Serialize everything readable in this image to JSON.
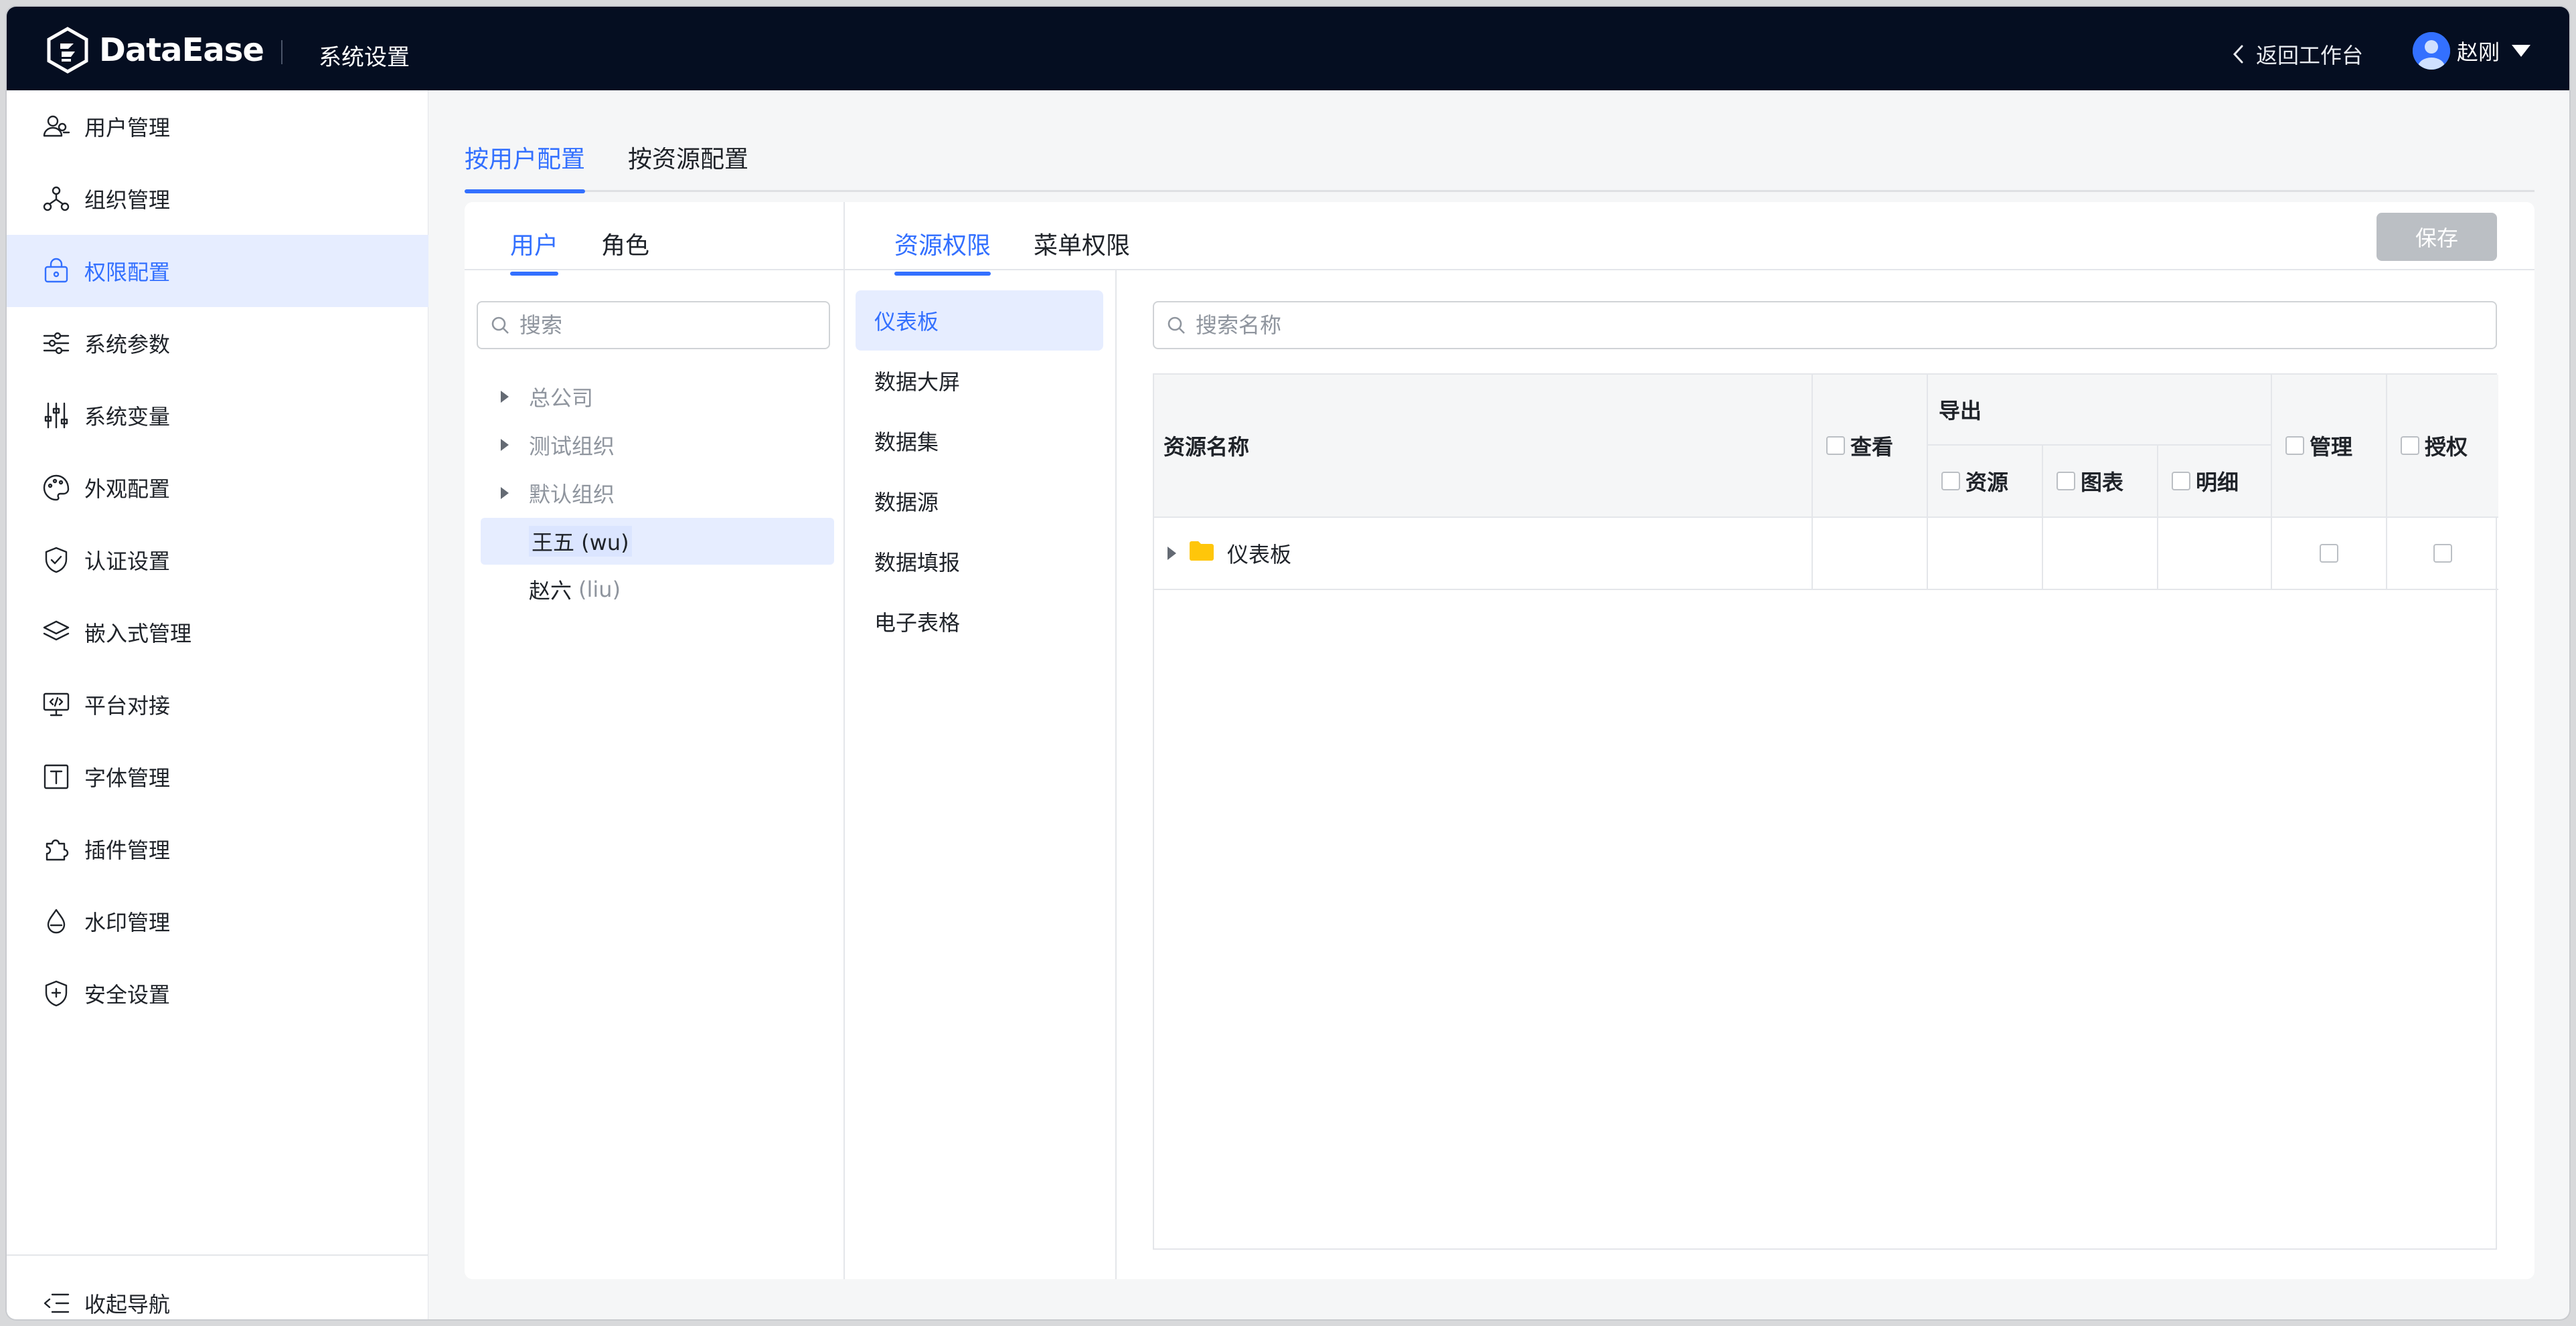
{
  "header": {
    "logo_text": "DataEase",
    "section_title": "系统设置",
    "back_label": "返回工作台",
    "user_name": "赵刚"
  },
  "sidebar": {
    "items": [
      {
        "label": "用户管理",
        "icon": "users-icon"
      },
      {
        "label": "组织管理",
        "icon": "org-icon"
      },
      {
        "label": "权限配置",
        "icon": "lock-icon",
        "active": true
      },
      {
        "label": "系统参数",
        "icon": "sliders-icon"
      },
      {
        "label": "系统变量",
        "icon": "variables-icon"
      },
      {
        "label": "外观配置",
        "icon": "palette-icon"
      },
      {
        "label": "认证设置",
        "icon": "shield-check-icon"
      },
      {
        "label": "嵌入式管理",
        "icon": "layers-icon"
      },
      {
        "label": "平台对接",
        "icon": "monitor-code-icon"
      },
      {
        "label": "字体管理",
        "icon": "font-icon"
      },
      {
        "label": "插件管理",
        "icon": "puzzle-icon"
      },
      {
        "label": "水印管理",
        "icon": "drop-icon"
      },
      {
        "label": "安全设置",
        "icon": "shield-plus-icon"
      }
    ],
    "collapse_label": "收起导航"
  },
  "main_tabs": [
    {
      "label": "按用户配置",
      "active": true
    },
    {
      "label": "按资源配置",
      "active": false
    }
  ],
  "left_panel": {
    "tabs": [
      {
        "label": "用户",
        "active": true
      },
      {
        "label": "角色",
        "active": false
      }
    ],
    "search_placeholder": "搜索",
    "tree": [
      {
        "label": "总公司",
        "type": "org"
      },
      {
        "label": "测试组织",
        "type": "org"
      },
      {
        "label": "默认组织",
        "type": "org"
      },
      {
        "label": "王五 (wu)",
        "type": "user",
        "selected": true
      },
      {
        "label": "赵六",
        "sub": "(liu)",
        "type": "user"
      }
    ]
  },
  "permission_tabs": [
    {
      "label": "资源权限",
      "active": true
    },
    {
      "label": "菜单权限",
      "active": false
    }
  ],
  "save_label": "保存",
  "resource_types": [
    {
      "label": "仪表板",
      "active": true
    },
    {
      "label": "数据大屏"
    },
    {
      "label": "数据集"
    },
    {
      "label": "数据源"
    },
    {
      "label": "数据填报"
    },
    {
      "label": "电子表格"
    }
  ],
  "right_panel": {
    "search_placeholder": "搜索名称",
    "columns": {
      "name": "资源名称",
      "view": "查看",
      "export": "导出",
      "export_resource": "资源",
      "export_chart": "图表",
      "export_detail": "明细",
      "manage": "管理",
      "authorize": "授权"
    },
    "rows": [
      {
        "name": "仪表板",
        "icon": "folder-icon"
      }
    ]
  },
  "colors": {
    "accent": "#3370ff",
    "topbar": "#050e21",
    "folder": "#ffc60a"
  }
}
